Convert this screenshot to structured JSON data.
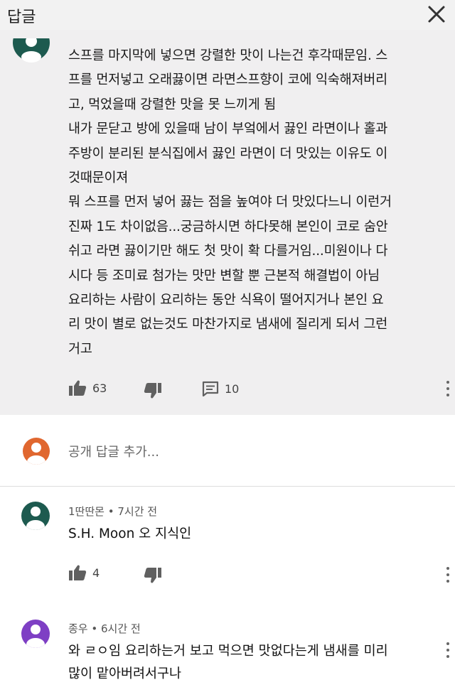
{
  "header": {
    "title": "답글"
  },
  "op_comment": {
    "lines": [
      "스프를 마지막에 넣으면 강렬한 맛이 나는건 후각때문임. 스",
      "프를 먼저넣고 오래끓이면 라면스프향이 코에 익숙해져버리",
      "고, 먹었을때 강렬한 맛을 못 느끼게 됨",
      "내가 문닫고 방에 있을때 남이 부엌에서 끓인 라면이나 홀과",
      "주방이 분리된 분식집에서 끓인 라면이 더 맛있는 이유도 이",
      "것때문이져",
      "뭐 스프를 먼저 넣어 끓는 점을 높여야 더 맛있다느니 이런거",
      "진짜 1도 차이없음...궁금하시면 하다못해 본인이 코로 숨안",
      "쉬고 라면 끓이기만 해도 첫 맛이 확 다를거임...미원이나 다",
      "시다 등 조미료 첨가는 맛만 변할 뿐 근본적 해결법이 아님",
      "요리하는 사람이 요리하는 동안 식욕이 떨어지거나 본인 요",
      "리 맛이 별로 없는것도 마찬가지로 냄새에 질리게 되서 그런",
      "거고"
    ],
    "likes": "63",
    "replies": "10"
  },
  "reply_input": {
    "placeholder": "공개 답글 추가..."
  },
  "replies": [
    {
      "author": "1딴딴몬",
      "time": "7시간 전",
      "text": "S.H. Moon 오 지식인",
      "likes": "4"
    },
    {
      "author": "종우",
      "time": "6시간 전",
      "text_lines": [
        "와 ㄹㅇ임 요리하는거 보고 먹으면 맛없다는게  냄새를 미리",
        "많이 맡아버려서구나"
      ]
    }
  ],
  "colors": {
    "header_bg": "#f2f2f2",
    "op_bg": "#f0eff0",
    "avatar_teal": "#1d5a4f",
    "avatar_orange": "#e0672f",
    "avatar_purple": "#7e3fc4",
    "icon_gray": "#606060"
  }
}
